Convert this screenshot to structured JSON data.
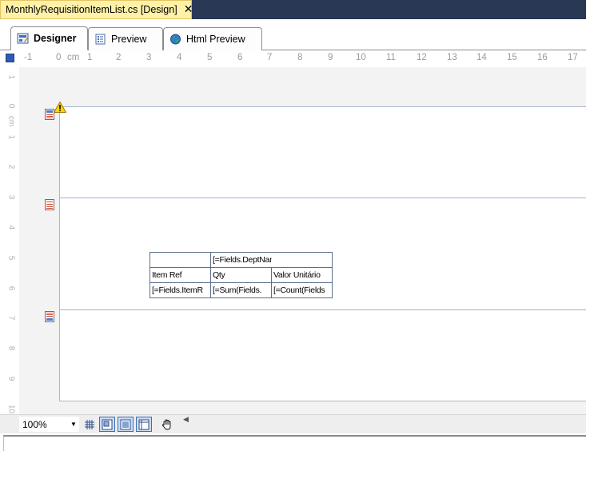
{
  "document_tab": {
    "title": "MonthlyRequisitionItemList.cs [Design]",
    "close_glyph": "✕"
  },
  "view_tabs": [
    {
      "label": "Designer",
      "icon": "designer-icon",
      "active": true
    },
    {
      "label": "Preview",
      "icon": "preview-icon",
      "active": false
    },
    {
      "label": "Html Preview",
      "icon": "globe-icon",
      "active": false
    }
  ],
  "horizontal_ruler": {
    "labels": [
      "-1",
      "0",
      "cm",
      "1",
      "2",
      "3",
      "4",
      "5",
      "6",
      "7",
      "8",
      "9",
      "10",
      "11",
      "12",
      "13",
      "14",
      "15",
      "16",
      "17"
    ]
  },
  "vertical_ruler": {
    "labels": [
      "1",
      "0",
      "cm",
      "1",
      "2",
      "3",
      "4",
      "5",
      "6",
      "7",
      "8",
      "9",
      "10"
    ]
  },
  "bands": [
    {
      "name": "page-header",
      "icon": "band-header-icon",
      "warning": true
    },
    {
      "name": "detail",
      "icon": "band-detail-icon",
      "warning": false
    },
    {
      "name": "page-footer",
      "icon": "band-footer-icon",
      "warning": false
    }
  ],
  "report_table": {
    "header_row": [
      "",
      "[=Fields.DeptName]",
      ""
    ],
    "column_headers": [
      "Item Ref",
      "Qty",
      "Valor Unitário"
    ],
    "detail_row": [
      "[=Fields.ItemR",
      "[=Sum(Fields.",
      "[=Count(Fields"
    ]
  },
  "bottom_toolbar": {
    "zoom": "100%",
    "buttons": [
      "grid-icon",
      "snap-to-grid-icon",
      "table-layout-icon",
      "ruler-toggle-icon",
      "hand-pan-icon"
    ],
    "pressed": [
      "snap-to-grid-icon",
      "table-layout-icon",
      "ruler-toggle-icon"
    ]
  },
  "colors": {
    "doc_tab_bg": "#fff1a8",
    "tab_strip_bg": "#293955",
    "canvas_bg": "#f3f3f3",
    "table_border": "#5b6f8f",
    "section_line": "#9fb4cf"
  }
}
